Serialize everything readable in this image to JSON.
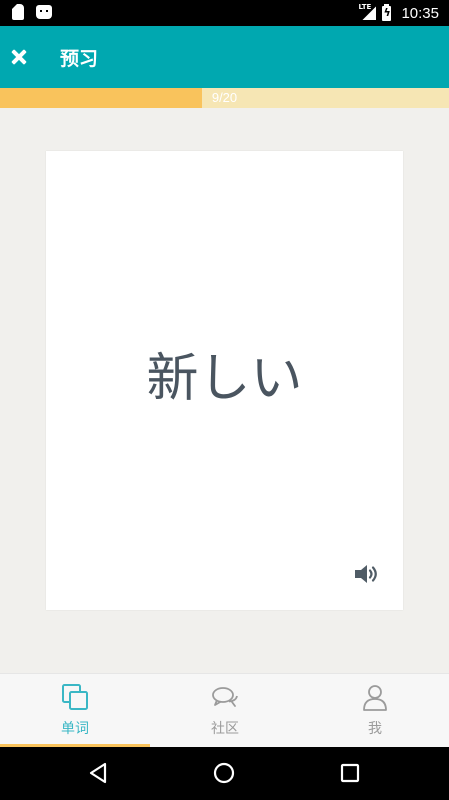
{
  "status_bar": {
    "time": "10:35",
    "network_label": "LTE"
  },
  "app_bar": {
    "title": "预习"
  },
  "progress": {
    "current": 9,
    "total": 20,
    "label": "9/20",
    "fraction": 0.45
  },
  "card": {
    "word": "新しい"
  },
  "bottom_nav": {
    "items": [
      {
        "label": "单词",
        "icon": "cards-icon",
        "active": true
      },
      {
        "label": "社区",
        "icon": "chat-icon",
        "active": false
      },
      {
        "label": "我",
        "icon": "person-icon",
        "active": false
      }
    ]
  },
  "colors": {
    "primary": "#00a8b0",
    "progress_fill": "#f9c35c",
    "progress_track": "#f6e6b4",
    "active_tab": "#3ab7c5",
    "inactive_tab": "#9b9b9b",
    "word_text": "#4a5560",
    "background": "#f1f0ed"
  }
}
